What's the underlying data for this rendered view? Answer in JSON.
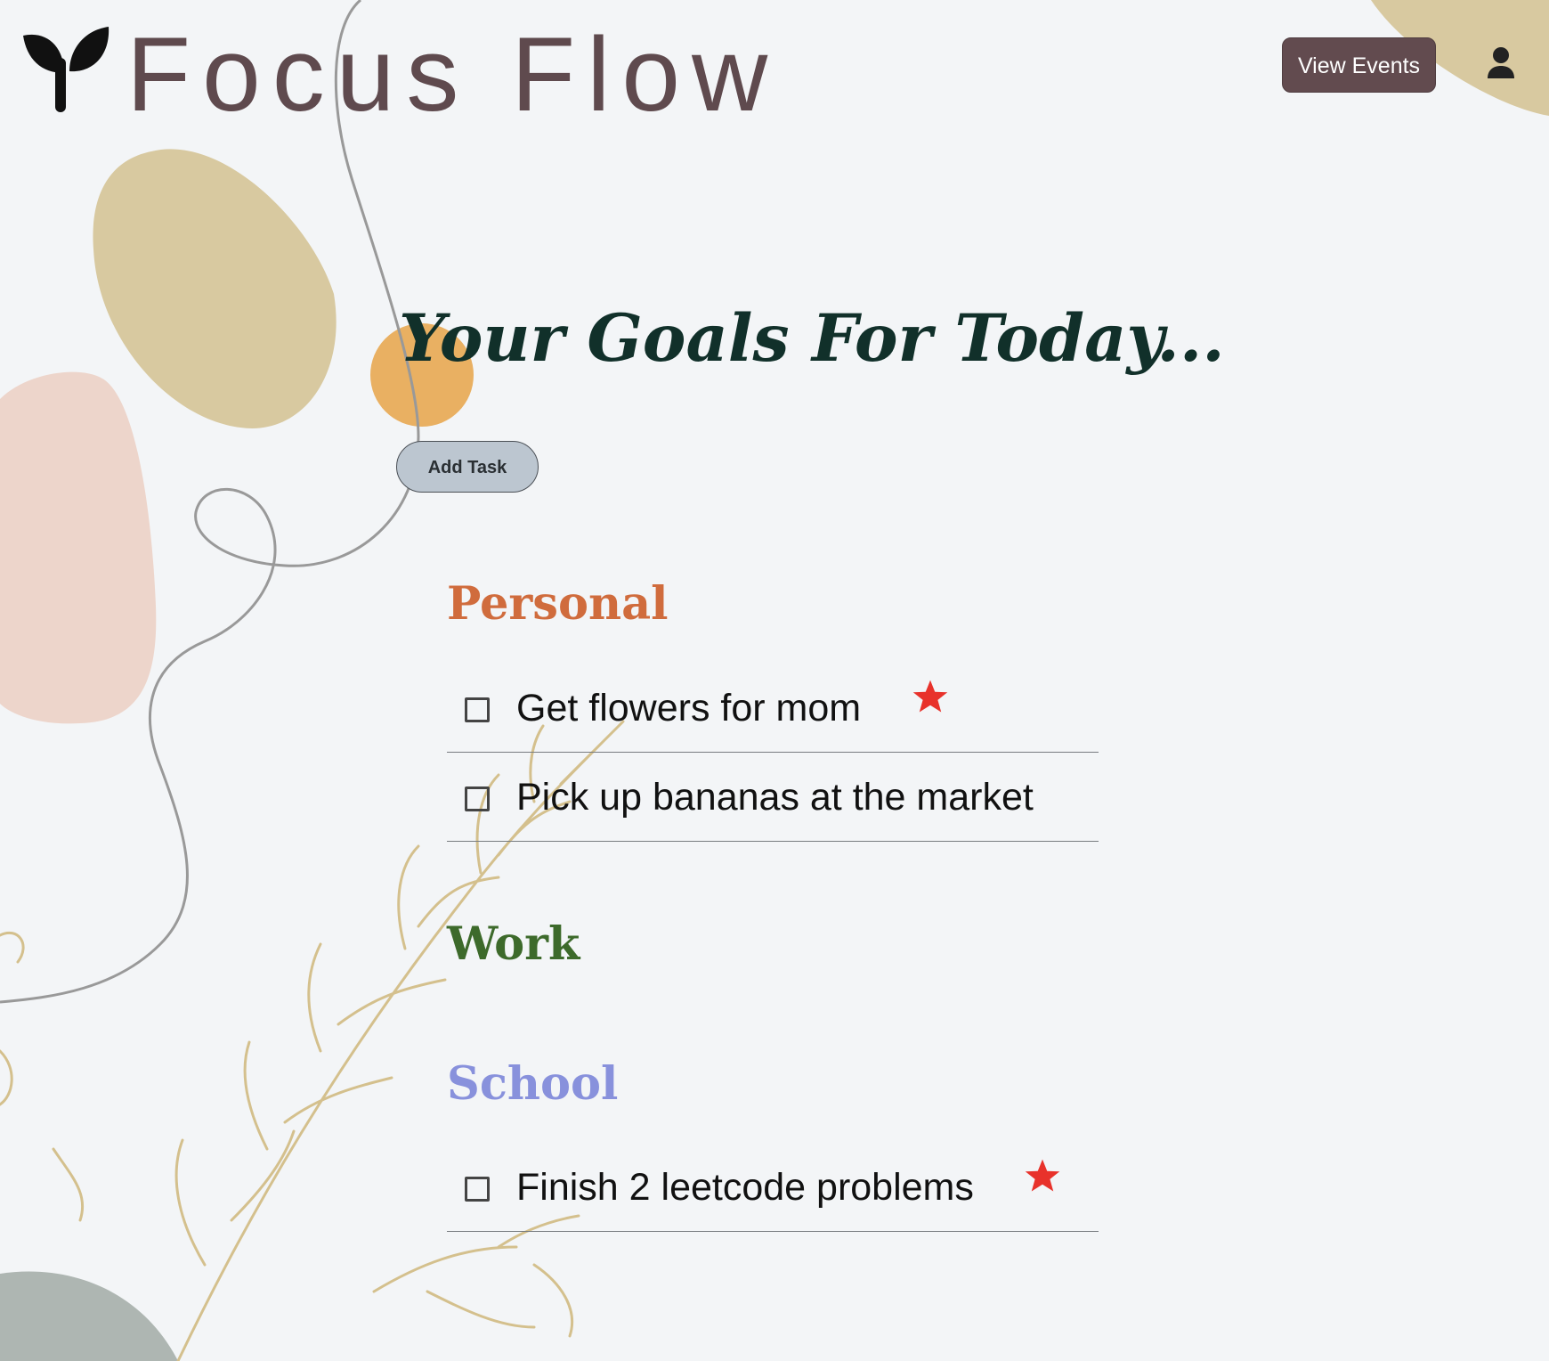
{
  "header": {
    "brand": "Focus Flow",
    "view_events_label": "View Events"
  },
  "main": {
    "title": "Your Goals For Today...",
    "add_task_label": "Add Task",
    "categories": [
      {
        "name": "Personal",
        "color": "#d06c3d",
        "tasks": [
          {
            "text": "Get flowers for mom",
            "checked": false,
            "starred": true,
            "star_icon": "star-icon"
          },
          {
            "text": "Pick up bananas at the market",
            "checked": false,
            "starred": false
          }
        ]
      },
      {
        "name": "Work",
        "color": "#3d6a2b",
        "tasks": []
      },
      {
        "name": "School",
        "color": "#8891dc",
        "tasks": [
          {
            "text": "Finish 2 leetcode problems",
            "checked": false,
            "starred": true,
            "star_icon": "star-icon"
          }
        ]
      }
    ]
  },
  "colors": {
    "background": "#f3f5f7",
    "brand_text": "#5f4a4e",
    "button_dark": "#624b4f",
    "add_task_button": "#bcc6d0",
    "title": "#11302a",
    "star": "#e8322b",
    "decor_tan": "#d8c9a0",
    "decor_pink": "#edd5cb",
    "decor_orange": "#e9b062",
    "decor_sage": "#aeb6b2",
    "decor_line": "#999999"
  },
  "icons": {
    "logo": "sprout-icon",
    "profile": "user-icon",
    "checkbox": "checkbox-icon",
    "star": "star-icon"
  }
}
